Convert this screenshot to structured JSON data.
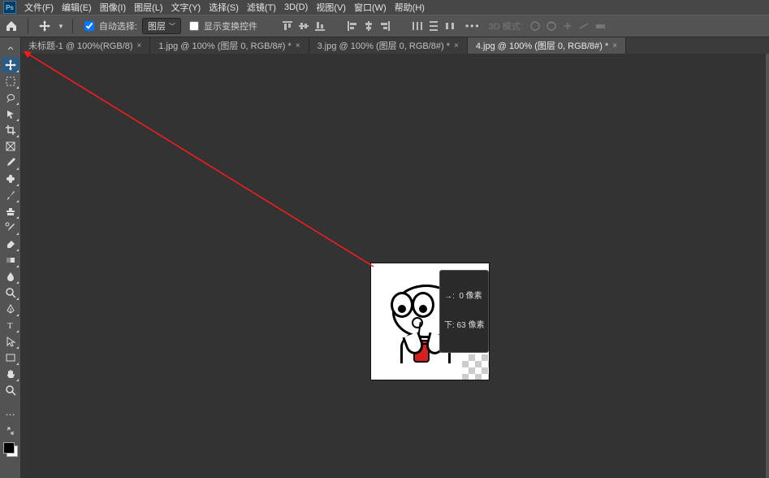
{
  "menubar": {
    "items": [
      "文件(F)",
      "编辑(E)",
      "图像(I)",
      "图层(L)",
      "文字(Y)",
      "选择(S)",
      "滤镜(T)",
      "3D(D)",
      "视图(V)",
      "窗口(W)",
      "帮助(H)"
    ]
  },
  "optionsbar": {
    "auto_select_label": "自动选择:",
    "layer_dropdown": "图层",
    "show_transform_label": "显示变换控件",
    "threeD_label": "3D 模式:"
  },
  "tabs": [
    {
      "label": "未标题-1 @ 100%(RGB/8)",
      "active": false
    },
    {
      "label": "1.jpg @ 100% (图层 0, RGB/8#) *",
      "active": false
    },
    {
      "label": "3.jpg @ 100% (图层 0, RGB/8#) *",
      "active": false
    },
    {
      "label": "4.jpg @ 100% (图层 0, RGB/8#) *",
      "active": true
    }
  ],
  "tool_names": [
    "move",
    "artboard",
    "marquee",
    "lasso",
    "quick-select",
    "crop",
    "frame",
    "eyedropper",
    "healing",
    "brush",
    "clone",
    "history-brush",
    "eraser",
    "gradient",
    "blur",
    "dodge",
    "pen",
    "type",
    "path-select",
    "rectangle",
    "hand",
    "zoom"
  ],
  "drag_tip": {
    "line1": "→:  0 像素",
    "line2": "下: 63 像素"
  }
}
